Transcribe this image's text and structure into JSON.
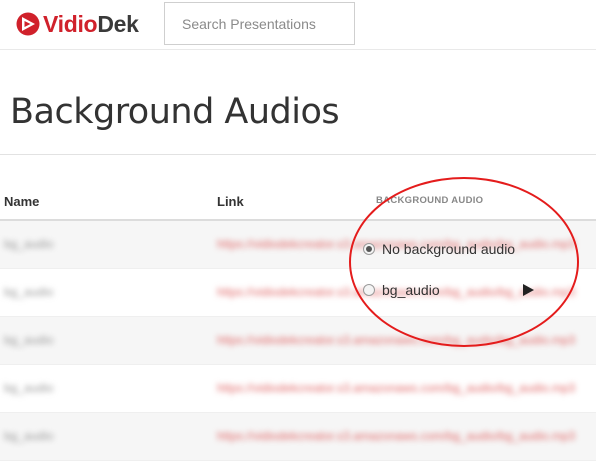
{
  "header": {
    "logo_part1": "Vidio",
    "logo_part2": "Dek",
    "search_placeholder": "Search Presentations"
  },
  "page": {
    "title": "Background Audios"
  },
  "table": {
    "columns": [
      "Name",
      "Link",
      "BACKGROUND AUDIO"
    ],
    "rows": [
      {
        "name": "bg_audio",
        "link": "https://vidiodekcreator.s3.amazonaws.com/bg_audio/bg_audio.mp3"
      },
      {
        "name": "bg_audio",
        "link": "https://vidiodekcreator.s3.amazonaws.com/bg_audio/bg_audio.mp3"
      },
      {
        "name": "bg_audio",
        "link": "https://vidiodekcreator.s3.amazonaws.com/bg_audio/bg_audio.mp3"
      },
      {
        "name": "bg_audio",
        "link": "https://vidiodekcreator.s3.amazonaws.com/bg_audio/bg_audio.mp3"
      },
      {
        "name": "bg_audio",
        "link": "https://vidiodekcreator.s3.amazonaws.com/bg_audio/bg_audio.mp3"
      }
    ]
  },
  "background_audio": {
    "options": [
      {
        "label": "No background audio",
        "selected": true
      },
      {
        "label": "bg_audio",
        "selected": false
      }
    ],
    "play_icon": "play-icon"
  },
  "colors": {
    "brand_red": "#d0212b",
    "highlight_circle": "#e41c1c"
  }
}
